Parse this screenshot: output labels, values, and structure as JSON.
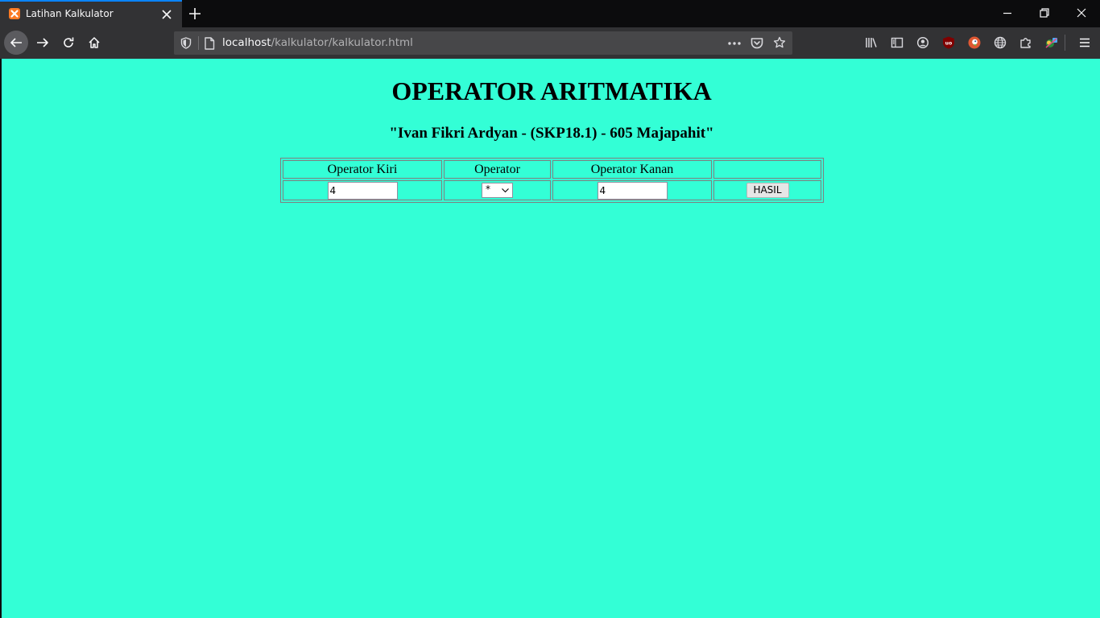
{
  "browser": {
    "tab": {
      "title": "Latihan Kalkulator"
    },
    "url": {
      "host": "localhost",
      "path": "/kalkulator/kalkulator.html"
    },
    "accent_color": "#0a84ff"
  },
  "page": {
    "background_color": "#33ffd6",
    "title": "OPERATOR ARITMATIKA",
    "subtitle": "\"Ivan Fikri Ardyan - (SKP18.1) - 605 Majapahit\"",
    "table": {
      "headers": [
        "Operator Kiri",
        "Operator",
        "Operator Kanan",
        ""
      ],
      "left_operand": "4",
      "operator": "*",
      "right_operand": "4",
      "submit_label": "HASIL"
    }
  }
}
